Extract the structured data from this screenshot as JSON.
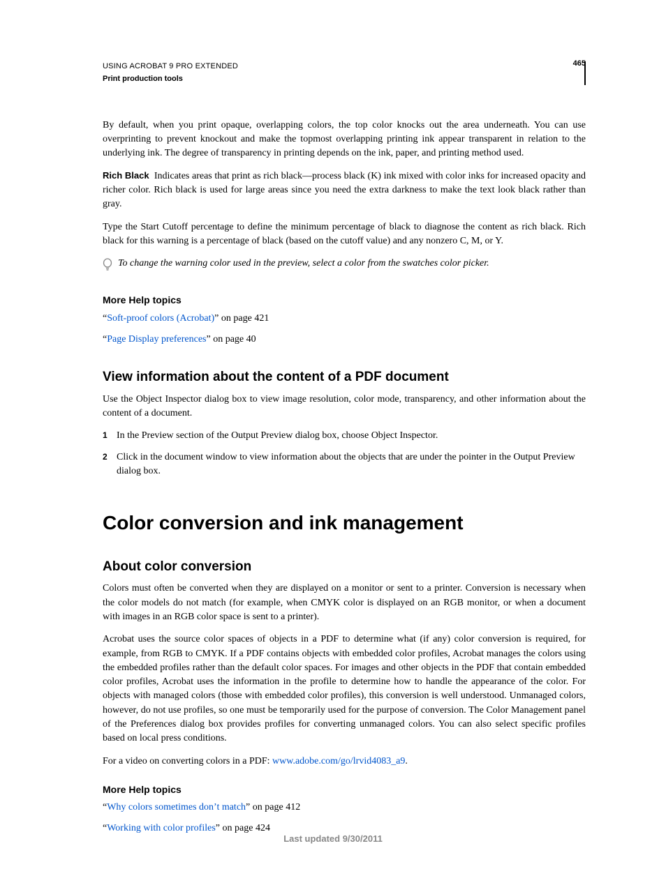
{
  "header": {
    "title": "USING ACROBAT 9 PRO EXTENDED",
    "subtitle": "Print production tools",
    "page": "465"
  },
  "para1": "By default, when you print opaque, overlapping colors, the top color knocks out the area underneath. You can use overprinting to prevent knockout and make the topmost overlapping printing ink appear transparent in relation to the underlying ink. The degree of transparency in printing depends on the ink, paper, and printing method used.",
  "richBlack": {
    "label": "Rich Black",
    "text": "Indicates areas that print as rich black—process black (K) ink mixed with color inks for increased opacity and richer color. Rich black is used for large areas since you need the extra darkness to make the text look black rather than gray."
  },
  "para3": "Type the Start Cutoff percentage to define the minimum percentage of black to diagnose the content as rich black. Rich black for this warning is a percentage of black (based on the cutoff value) and any nonzero C, M, or Y.",
  "tip": "To change the warning color used in the preview, select a color from the swatches color picker.",
  "help1": {
    "heading": "More Help topics",
    "l1_pre": "“",
    "l1_link": "Soft-proof colors (Acrobat)",
    "l1_post": "” on page 421",
    "l2_pre": "“",
    "l2_link": "Page Display preferences",
    "l2_post": "” on page 40"
  },
  "h2a": "View information about the content of a PDF document",
  "para4": "Use the Object Inspector dialog box to view image resolution, color mode, transparency, and other information about the content of a document.",
  "steps": {
    "n1": "1",
    "t1": "In the Preview section of the Output Preview dialog box, choose Object Inspector.",
    "n2": "2",
    "t2": "Click in the document window to view information about the objects that are under the pointer in the Output Preview dialog box."
  },
  "h1": "Color conversion and ink management",
  "h2b": "About color conversion",
  "para5": "Colors must often be converted when they are displayed on a monitor or sent to a printer. Conversion is necessary when the color models do not match (for example, when CMYK color is displayed on an RGB monitor, or when a document with images in an RGB color space is sent to a printer).",
  "para6": "Acrobat uses the source color spaces of objects in a PDF to determine what (if any) color conversion is required, for example, from RGB to CMYK. If a PDF contains objects with embedded color profiles, Acrobat manages the colors using the embedded profiles rather than the default color spaces. For images and other objects in the PDF that contain embedded color profiles, Acrobat uses the information in the profile to determine how to handle the appearance of the color. For objects with managed colors (those with embedded color profiles), this conversion is well understood. Unmanaged colors, however, do not use profiles, so one must be temporarily used for the purpose of conversion. The Color Management panel of the Preferences dialog box provides profiles for converting unmanaged colors. You can also select specific profiles based on local press conditions.",
  "videoLine": {
    "pre": "For a video on converting colors in a PDF: ",
    "link": "www.adobe.com/go/lrvid4083_a9",
    "post": "."
  },
  "help2": {
    "heading": "More Help topics",
    "l1_pre": "“",
    "l1_link": "Why colors sometimes don’t match",
    "l1_post": "” on page 412",
    "l2_pre": "“",
    "l2_link": "Working with color profiles",
    "l2_post": "” on page 424"
  },
  "footer": "Last updated 9/30/2011"
}
